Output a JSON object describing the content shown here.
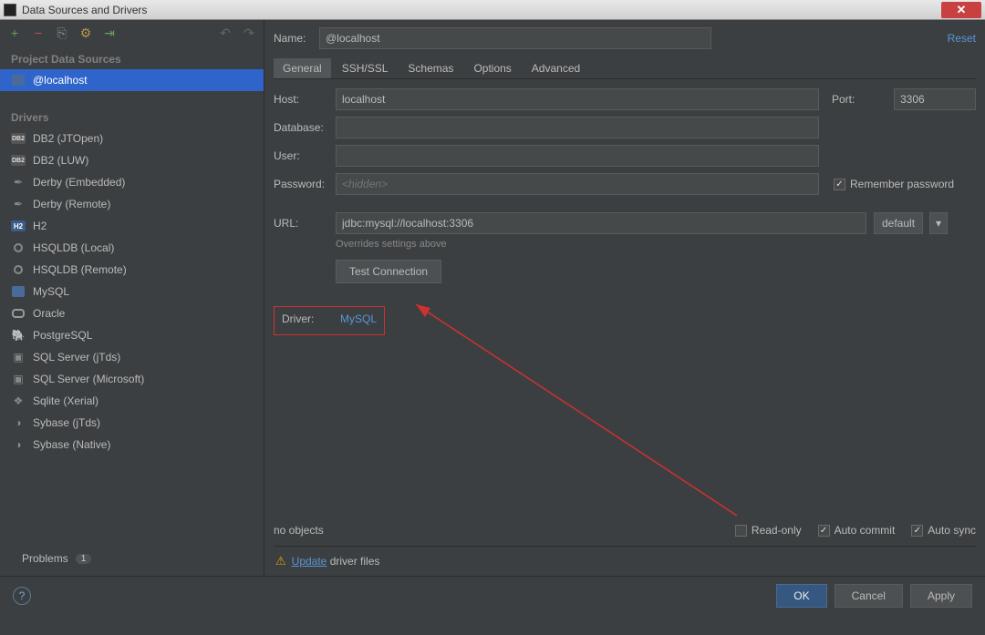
{
  "titlebar": {
    "title": "Data Sources and Drivers"
  },
  "toolbar": {
    "add": "+",
    "remove": "−",
    "copy": "⎘",
    "settings": "⚙",
    "import": "⇥",
    "undo": "↶",
    "redo": "↷"
  },
  "sidebar": {
    "sources_header": "Project Data Sources",
    "sources": [
      {
        "label": "@localhost",
        "icon": "mysql-icon"
      }
    ],
    "drivers_header": "Drivers",
    "drivers": [
      {
        "label": "DB2 (JTOpen)",
        "icon": "db2"
      },
      {
        "label": "DB2 (LUW)",
        "icon": "db2"
      },
      {
        "label": "Derby (Embedded)",
        "icon": "feather"
      },
      {
        "label": "Derby (Remote)",
        "icon": "feather"
      },
      {
        "label": "H2",
        "icon": "h2"
      },
      {
        "label": "HSQLDB (Local)",
        "icon": "dot"
      },
      {
        "label": "HSQLDB (Remote)",
        "icon": "dot"
      },
      {
        "label": "MySQL",
        "icon": "mysql"
      },
      {
        "label": "Oracle",
        "icon": "oracle"
      },
      {
        "label": "PostgreSQL",
        "icon": "pg"
      },
      {
        "label": "SQL Server (jTds)",
        "icon": "sqls"
      },
      {
        "label": "SQL Server (Microsoft)",
        "icon": "sqls"
      },
      {
        "label": "Sqlite (Xerial)",
        "icon": "sqlite"
      },
      {
        "label": "Sybase (jTds)",
        "icon": "sybase"
      },
      {
        "label": "Sybase (Native)",
        "icon": "sybase"
      }
    ],
    "problems_label": "Problems",
    "problems_count": "1"
  },
  "content": {
    "name_label": "Name:",
    "name_value": "@localhost",
    "reset_label": "Reset",
    "tabs": [
      "General",
      "SSH/SSL",
      "Schemas",
      "Options",
      "Advanced"
    ],
    "active_tab": 0,
    "host_label": "Host:",
    "host_value": "localhost",
    "port_label": "Port:",
    "port_value": "3306",
    "db_label": "Database:",
    "db_value": "",
    "user_label": "User:",
    "user_value": "",
    "pw_label": "Password:",
    "pw_placeholder": "<hidden>",
    "remember_label": "Remember password",
    "remember_checked": true,
    "url_label": "URL:",
    "url_value": "jdbc:mysql://localhost:3306",
    "url_mode": "default",
    "url_hint": "Overrides settings above",
    "test_label": "Test Connection",
    "driver_label": "Driver:",
    "driver_value": "MySQL",
    "no_objects": "no objects",
    "readonly_label": "Read-only",
    "readonly_checked": false,
    "autocommit_label": "Auto commit",
    "autocommit_checked": true,
    "autosync_label": "Auto sync",
    "autosync_checked": true,
    "warn_update": "Update",
    "warn_text": " driver files"
  },
  "buttons": {
    "ok": "OK",
    "cancel": "Cancel",
    "apply": "Apply"
  }
}
